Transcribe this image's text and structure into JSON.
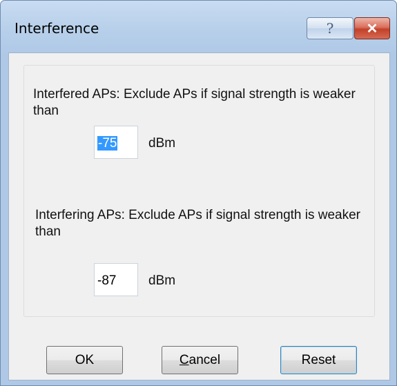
{
  "window": {
    "title": "Interference",
    "help_label": "?",
    "close_label": "✕"
  },
  "interfered": {
    "label": "Interfered APs: Exclude APs if signal strength is weaker than",
    "value": "-75",
    "unit": "dBm"
  },
  "interfering": {
    "label": "Interfering APs: Exclude APs if signal strength is weaker than",
    "value": "-87",
    "unit": "dBm"
  },
  "buttons": {
    "ok": "OK",
    "cancel_first": "C",
    "cancel_rest": "ancel",
    "reset": "Reset"
  }
}
